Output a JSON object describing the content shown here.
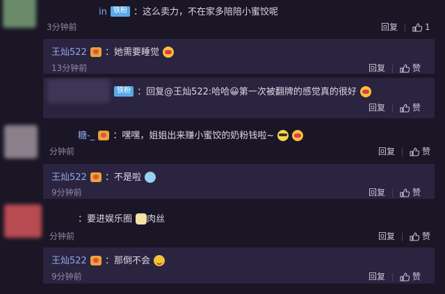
{
  "comments": [
    {
      "id": "c1",
      "username_tail": "in",
      "badge": "铁粉",
      "text": "：这么卖力，不在家多陪陪小蜜饺呢",
      "time": "3分钟前",
      "reply_label": "回复",
      "like_count": "1"
    },
    {
      "id": "r1",
      "username": "王灿522",
      "text": "：她需要睡觉",
      "time": "13分钟前",
      "reply_label": "回复",
      "like_label": "赞"
    },
    {
      "id": "c2",
      "badge": "铁粉",
      "text": "：回复@王灿522:哈哈😀第一次被翻牌的感觉真的很好",
      "reply_label": "回复",
      "like_label": "赞"
    },
    {
      "id": "c3",
      "username_tail": "糖-_",
      "text": "：嘿嘿，姐姐出来赚小蜜饺的奶粉钱啦~",
      "time": "分钟前",
      "reply_label": "回复",
      "like_label": "赞"
    },
    {
      "id": "r2",
      "username": "王灿522",
      "text": "：不是啦",
      "time": "9分钟前",
      "reply_label": "回复",
      "like_label": "赞"
    },
    {
      "id": "c4",
      "text": "：要进娱乐圈",
      "text_tail": "肉丝",
      "time": "分钟前",
      "reply_label": "回复",
      "like_label": "赞"
    },
    {
      "id": "r3",
      "username": "王灿522",
      "text": "：那倒不会",
      "time": "9分钟前",
      "reply_label": "回复",
      "like_label": "赞"
    }
  ],
  "colors": {
    "background": "#1a1626",
    "reply_box": "#2b2440",
    "username": "#8fa8e6",
    "badge": "#5aa9e6"
  }
}
